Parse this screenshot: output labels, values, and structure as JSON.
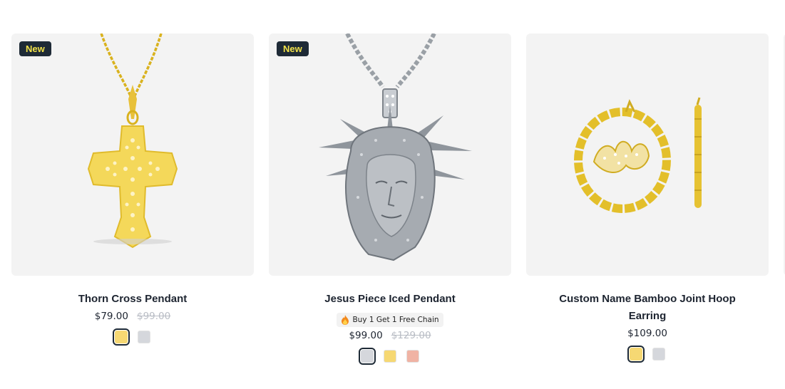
{
  "products": [
    {
      "badge": "New",
      "title": "Thorn Cross Pendant",
      "price": "$79.00",
      "compare_price": "$99.00",
      "swatches": [
        {
          "color": "#f6d873",
          "name": "gold",
          "selected": true
        },
        {
          "color": "#d5d7dc",
          "name": "silver",
          "selected": false
        }
      ]
    },
    {
      "badge": "New",
      "title": "Jesus Piece Iced Pendant",
      "promo": "Buy 1 Get 1 Free Chain",
      "price": "$99.00",
      "compare_price": "$129.00",
      "swatches": [
        {
          "color": "#d5d7dc",
          "name": "silver",
          "selected": true
        },
        {
          "color": "#f6d873",
          "name": "gold",
          "selected": false
        },
        {
          "color": "#f0b3a4",
          "name": "rose-gold",
          "selected": false
        }
      ]
    },
    {
      "title": "Custom Name Bamboo Joint Hoop Earring",
      "price": "$109.00",
      "swatches": [
        {
          "color": "#f6d873",
          "name": "gold",
          "selected": true
        },
        {
          "color": "#d5d7dc",
          "name": "silver",
          "selected": false
        }
      ]
    }
  ],
  "icons": {
    "promo": "fire-icon"
  }
}
